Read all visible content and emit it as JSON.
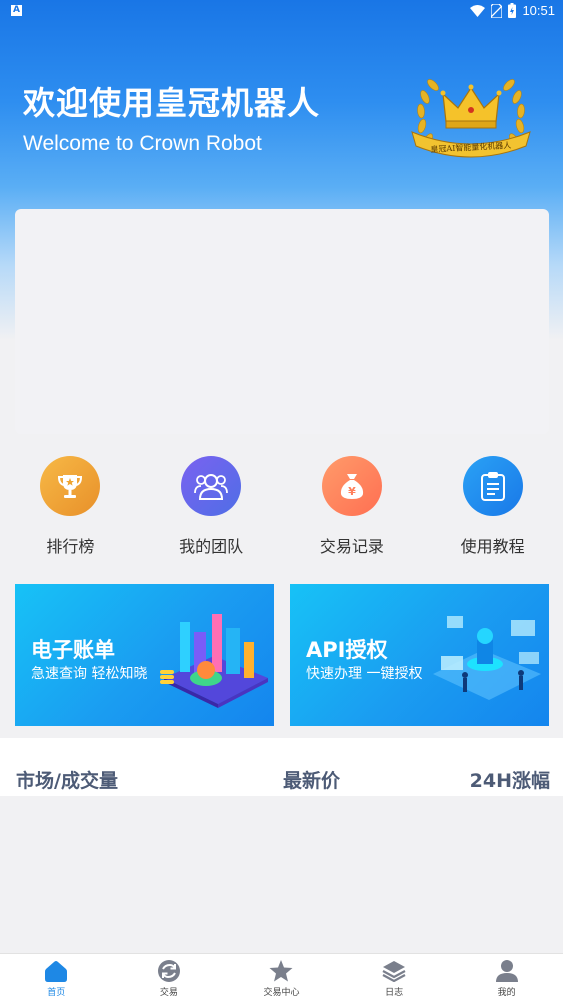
{
  "status_bar": {
    "time": "10:51",
    "app_badge": "A"
  },
  "hero": {
    "title": "欢迎使用皇冠机器人",
    "subtitle": "Welcome to Crown Robot",
    "logo_ribbon_text": "皇冠AI智能量化机器人"
  },
  "quick_menu": [
    {
      "label": "排行榜",
      "icon": "trophy-icon",
      "color": "#efa531"
    },
    {
      "label": "我的团队",
      "icon": "team-icon",
      "color": "#6a67e8"
    },
    {
      "label": "交易记录",
      "icon": "money-bag-icon",
      "color": "#ff7f5b"
    },
    {
      "label": "使用教程",
      "icon": "clipboard-icon",
      "color": "#1e88f0"
    }
  ],
  "feature_cards": [
    {
      "title": "电子账单",
      "subtitle": "急速查询 轻松知晓"
    },
    {
      "title": "API授权",
      "subtitle": "快速办理 一键授权"
    }
  ],
  "market_header": {
    "col_market": "市场/成交量",
    "col_price": "最新价",
    "col_change": "24H涨幅"
  },
  "bottom_nav": [
    {
      "label": "首页",
      "icon": "home-icon",
      "active": true
    },
    {
      "label": "交易",
      "icon": "exchange-icon",
      "active": false
    },
    {
      "label": "交易中心",
      "icon": "star-icon",
      "active": false
    },
    {
      "label": "日志",
      "icon": "layers-icon",
      "active": false
    },
    {
      "label": "我的",
      "icon": "user-icon",
      "active": false
    }
  ],
  "colors": {
    "accent": "#1e88e5",
    "hero_top": "#1976e6",
    "card_blue": "#1a9cf1"
  }
}
